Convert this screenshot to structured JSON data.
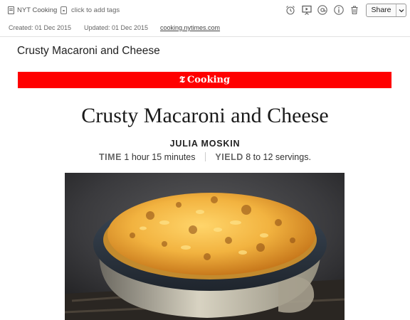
{
  "toolbar": {
    "notebook_label": "NYT Cooking",
    "tags_placeholder": "click to add tags",
    "share_label": "Share",
    "icons": [
      "reminder-alarm-icon",
      "presentation-icon",
      "work-chat-icon",
      "info-icon",
      "trash-icon",
      "chevron-down-icon"
    ]
  },
  "meta": {
    "created": "Created: 01 Dec 2015",
    "updated": "Updated: 01 Dec 2015",
    "source_url": "cooking.nytimes.com"
  },
  "note": {
    "title": "Crusty Macaroni and Cheese",
    "banner": {
      "logo": "𝕿",
      "text": "Cooking",
      "color": "#ff0000"
    },
    "recipe": {
      "title": "Crusty Macaroni and Cheese",
      "author": "JULIA MOSKIN",
      "time_label": "TIME",
      "time_value": "1 hour 15 minutes",
      "yield_label": "YIELD",
      "yield_value": "8 to 12 servings."
    }
  }
}
